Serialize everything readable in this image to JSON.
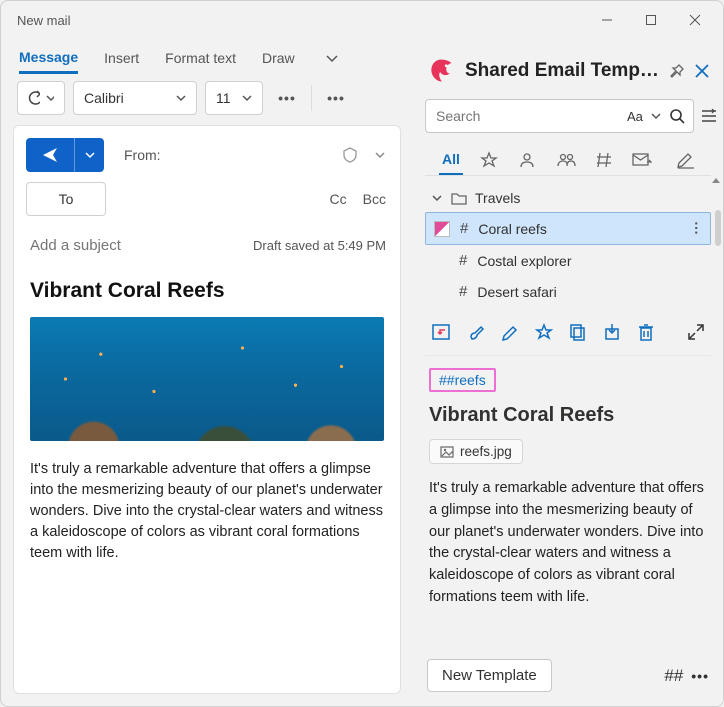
{
  "window": {
    "title": "New mail"
  },
  "ribbon": {
    "tabs": [
      "Message",
      "Insert",
      "Format text",
      "Draw"
    ],
    "active": 0
  },
  "toolbar": {
    "font": "Calibri",
    "size": "11"
  },
  "compose": {
    "from_label": "From:",
    "to_label": "To",
    "cc_label": "Cc",
    "bcc_label": "Bcc",
    "subject_placeholder": "Add a subject",
    "draft_status": "Draft saved at 5:49 PM",
    "heading": "Vibrant Coral Reefs",
    "body": "It's truly a remarkable adventure that offers a glimpse into the mesmerizing beauty of our planet's underwater wonders. Dive into the crystal-clear waters and witness a kaleidoscope of colors as vibrant coral formations teem with life."
  },
  "panel": {
    "title": "Shared Email Temp…",
    "search_placeholder": "Search",
    "search_case": "Aa",
    "filters": {
      "all_label": "All"
    },
    "folder": "Travels",
    "items": [
      {
        "label": "Coral reefs",
        "selected": true
      },
      {
        "label": "Costal explorer",
        "selected": false
      },
      {
        "label": "Desert safari",
        "selected": false
      }
    ],
    "tag": "##reefs",
    "preview_heading": "Vibrant Coral Reefs",
    "attachment": "reefs.jpg",
    "preview_body": "It's truly a remarkable adventure that offers a glimpse into the mesmerizing beauty of our planet's underwater wonders. Dive into the crystal-clear waters and witness a kaleidoscope of colors as vibrant coral formations teem with life.",
    "new_template_label": "New Template",
    "shortcut_label": "##"
  }
}
